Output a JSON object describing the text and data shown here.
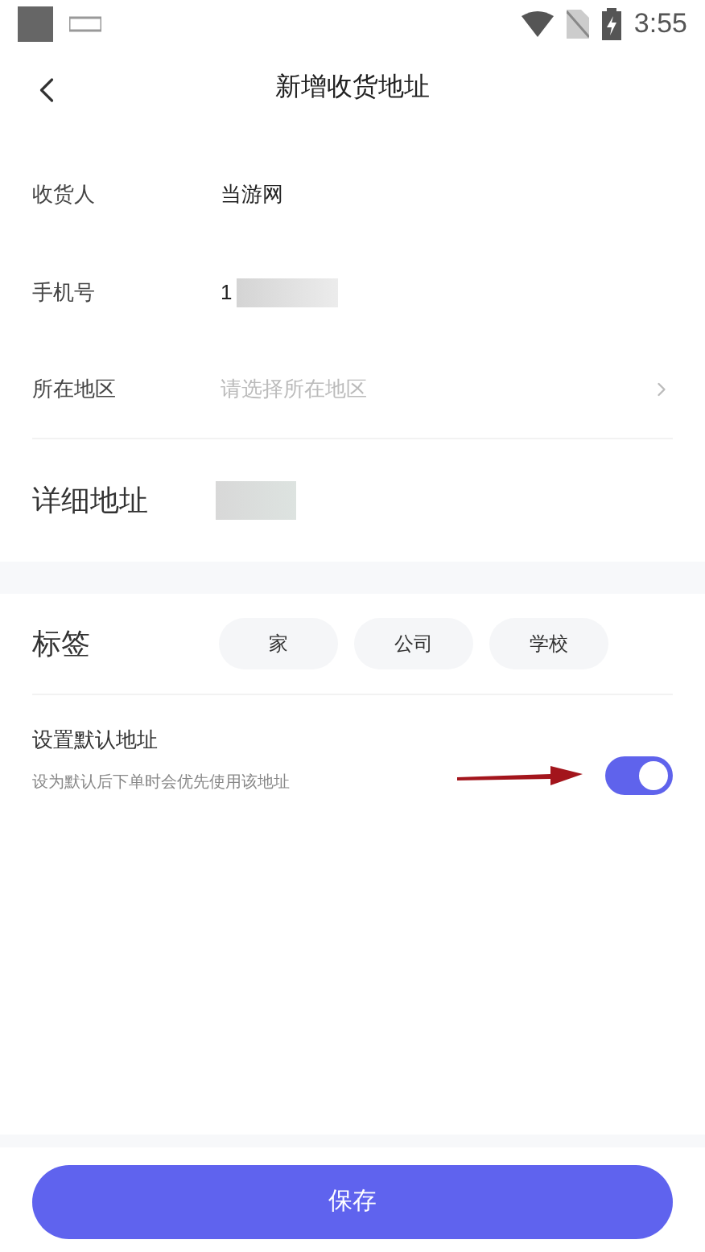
{
  "status_bar": {
    "time": "3:55"
  },
  "header": {
    "title": "新增收货地址"
  },
  "form": {
    "recipient": {
      "label": "收货人",
      "value": "当游网"
    },
    "phone": {
      "label": "手机号",
      "value": "1"
    },
    "region": {
      "label": "所在地区",
      "placeholder": "请选择所在地区"
    },
    "detail": {
      "label": "详细地址"
    }
  },
  "tags": {
    "label": "标签",
    "items": [
      {
        "label": "家"
      },
      {
        "label": "公司"
      },
      {
        "label": "学校"
      }
    ]
  },
  "default_address": {
    "title": "设置默认地址",
    "hint": "设为默认后下单时会优先使用该地址",
    "on": true
  },
  "save_button": {
    "label": "保存"
  }
}
